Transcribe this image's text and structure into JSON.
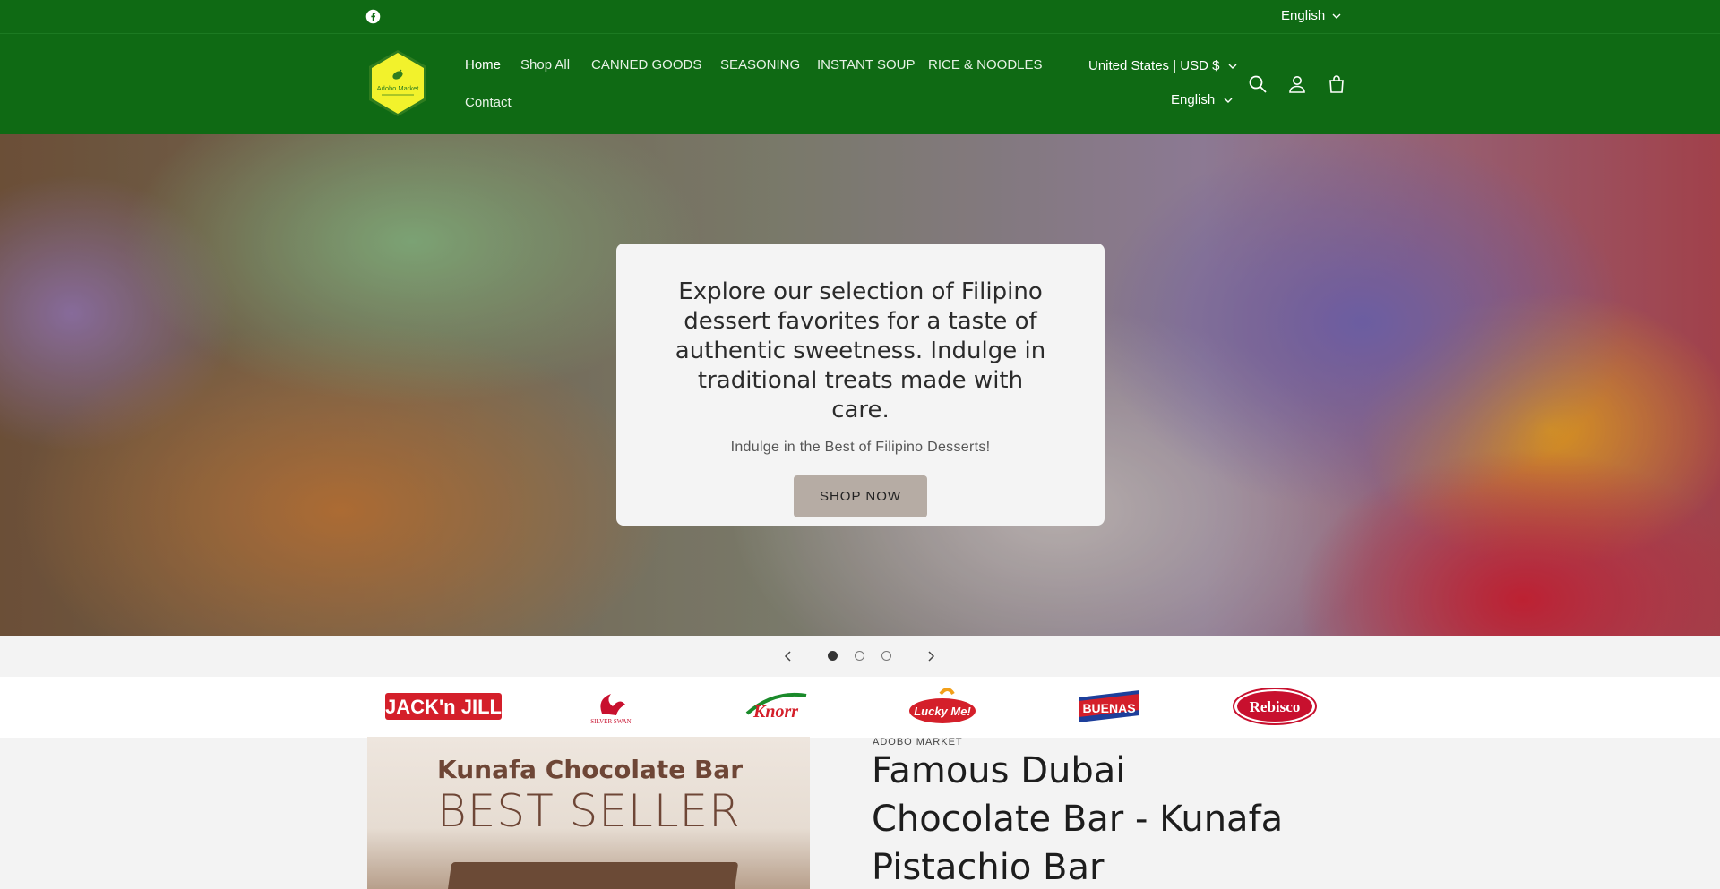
{
  "topbar": {
    "language": "English",
    "social_icon": "facebook-icon"
  },
  "header": {
    "logo_text": "Adobo Market",
    "nav": [
      "Home",
      "Shop All",
      "CANNED GOODS",
      "SEASONING",
      "INSTANT SOUP",
      "RICE & NOODLES",
      "Contact"
    ],
    "country": "United States | USD $",
    "language": "English",
    "icons": [
      "search-icon",
      "account-icon",
      "cart-icon"
    ]
  },
  "hero": {
    "heading": "Explore our selection of Filipino dessert favorites for a taste of authentic sweetness. Indulge in traditional treats made with care.",
    "subheading": "Indulge in the Best of Filipino Desserts!",
    "button": "SHOP NOW",
    "slides_total": 3,
    "active_slide": 1
  },
  "brands": [
    "JACK'n JILL",
    "SILVER SWAN",
    "Knorr",
    "Lucky Me!",
    "BUENAS",
    "Rebisco"
  ],
  "product": {
    "image_title": "Kunafa Chocolate Bar",
    "image_subtitle": "BEST SELLER",
    "vendor": "ADOBO MARKET",
    "title": "Famous Dubai Chocolate Bar - Kunafa Pistachio Bar"
  },
  "colors": {
    "header_green": "#0f6a14",
    "button": "#b6aca4",
    "logo_yellow": "#f2f22c"
  }
}
